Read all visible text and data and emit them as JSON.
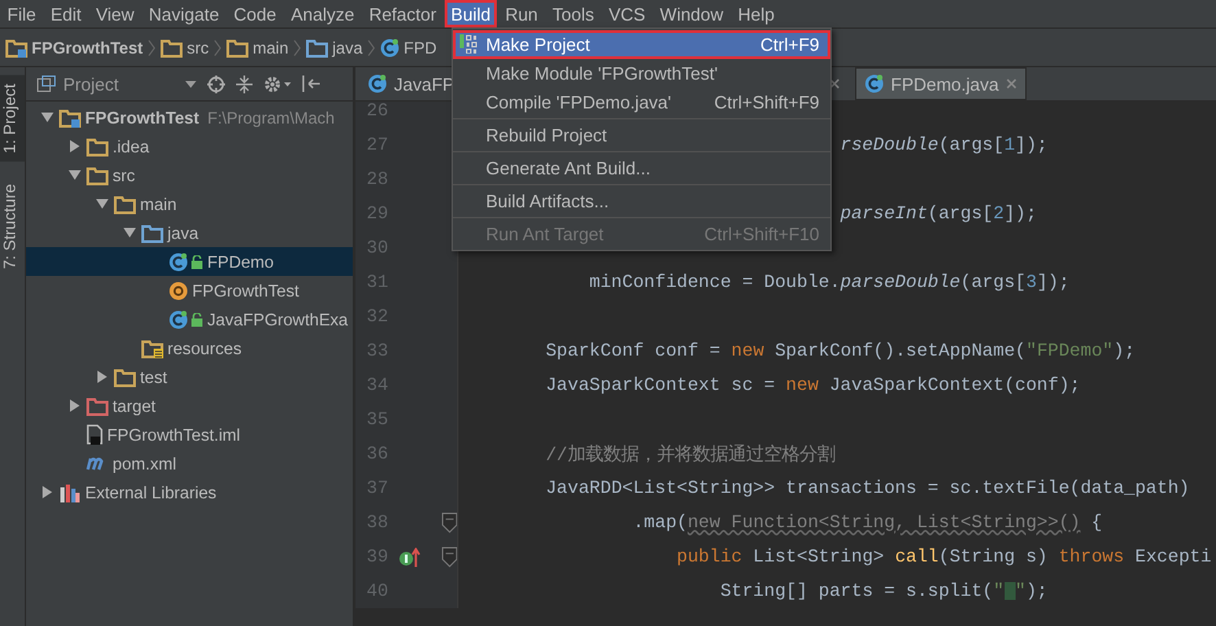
{
  "menu_bar": {
    "items": [
      {
        "label": "File",
        "selected": false,
        "annotated": false
      },
      {
        "label": "Edit",
        "selected": false,
        "annotated": false
      },
      {
        "label": "View",
        "selected": false,
        "annotated": false
      },
      {
        "label": "Navigate",
        "selected": false,
        "annotated": false
      },
      {
        "label": "Code",
        "selected": false,
        "annotated": false
      },
      {
        "label": "Analyze",
        "selected": false,
        "annotated": false
      },
      {
        "label": "Refactor",
        "selected": false,
        "annotated": false
      },
      {
        "label": "Build",
        "selected": true,
        "annotated": true
      },
      {
        "label": "Run",
        "selected": false,
        "annotated": false
      },
      {
        "label": "Tools",
        "selected": false,
        "annotated": false
      },
      {
        "label": "VCS",
        "selected": false,
        "annotated": false
      },
      {
        "label": "Window",
        "selected": false,
        "annotated": false
      },
      {
        "label": "Help",
        "selected": false,
        "annotated": false
      }
    ]
  },
  "build_menu": {
    "items": [
      {
        "kind": "icon-item",
        "label": "Make Project",
        "shortcut": "Ctrl+F9",
        "selected": true,
        "disabled": false,
        "annotated": true
      },
      {
        "kind": "item",
        "label": "Make Module 'FPGrowthTest'",
        "selected": false,
        "disabled": false,
        "annotated": false
      },
      {
        "kind": "item",
        "label": "Compile 'FPDemo.java'",
        "shortcut": "Ctrl+Shift+F9",
        "selected": false,
        "disabled": false,
        "annotated": false
      },
      {
        "kind": "separator"
      },
      {
        "kind": "item",
        "label": "Rebuild Project",
        "selected": false,
        "disabled": false,
        "annotated": false
      },
      {
        "kind": "separator"
      },
      {
        "kind": "item",
        "label": "Generate Ant Build...",
        "selected": false,
        "disabled": false,
        "annotated": false
      },
      {
        "kind": "separator"
      },
      {
        "kind": "item",
        "label": "Build Artifacts...",
        "selected": false,
        "disabled": false,
        "annotated": false
      },
      {
        "kind": "separator"
      },
      {
        "kind": "item",
        "label": "Run Ant Target",
        "shortcut": "Ctrl+Shift+F10",
        "selected": false,
        "disabled": true,
        "annotated": false
      }
    ]
  },
  "breadcrumbs": [
    {
      "label": "FPGrowthTest",
      "kind": "module"
    },
    {
      "label": "src",
      "kind": "folder"
    },
    {
      "label": "main",
      "kind": "folder"
    },
    {
      "label": "java",
      "kind": "source-folder"
    },
    {
      "label": "FPD",
      "kind": "class"
    }
  ],
  "tool_stripe": [
    {
      "label": "1: Project",
      "selected": true
    },
    {
      "label": "7: Structure",
      "selected": false
    }
  ],
  "project_panel": {
    "title": "Project",
    "tree": [
      {
        "label": "FPGrowthTest",
        "path": "F:\\Program\\Mach",
        "kind": "module",
        "expanded": true,
        "selected": false,
        "children": [
          {
            "label": ".idea",
            "kind": "folder",
            "expanded": false,
            "selected": false
          },
          {
            "label": "src",
            "kind": "folder",
            "expanded": true,
            "selected": false,
            "children": [
              {
                "label": "main",
                "kind": "folder",
                "expanded": true,
                "selected": false,
                "children": [
                  {
                    "label": "java",
                    "kind": "source-folder",
                    "expanded": true,
                    "selected": false,
                    "children": [
                      {
                        "label": "FPDemo",
                        "kind": "class",
                        "locked": true,
                        "selected": true
                      },
                      {
                        "label": "FPGrowthTest",
                        "kind": "object",
                        "selected": false
                      },
                      {
                        "label": "JavaFPGrowthExa",
                        "kind": "class",
                        "locked": true,
                        "selected": false
                      }
                    ]
                  },
                  {
                    "label": "resources",
                    "kind": "resource-folder",
                    "selected": false
                  }
                ]
              },
              {
                "label": "test",
                "kind": "folder",
                "expanded": false,
                "selected": false
              }
            ]
          },
          {
            "label": "target",
            "kind": "excluded-folder",
            "expanded": false,
            "selected": false
          },
          {
            "label": "FPGrowthTest.iml",
            "kind": "file",
            "selected": false
          },
          {
            "label": "pom.xml",
            "kind": "maven",
            "selected": false
          }
        ]
      },
      {
        "label": "External Libraries",
        "kind": "library",
        "expanded": false,
        "selected": false
      }
    ]
  },
  "editor": {
    "tabs": [
      {
        "label": "JavaFP",
        "selected": false
      },
      {
        "label": "FPDemo.java",
        "selected": true
      }
    ],
    "lines": [
      {
        "number": "26",
        "kind": "plain"
      },
      {
        "number": "27",
        "kind": "plain",
        "tokens": [
          {
            "text": "rseDouble",
            "kind": "static"
          },
          {
            "text": "(args[",
            "kind": "plain"
          },
          {
            "text": "1",
            "kind": "number"
          },
          {
            "text": "]);",
            "kind": "plain"
          }
        ]
      },
      {
        "number": "28",
        "kind": "plain"
      },
      {
        "number": "29",
        "kind": "plain",
        "tokens": [
          {
            "text": "parseInt",
            "kind": "static"
          },
          {
            "text": "(args[",
            "kind": "plain"
          },
          {
            "text": "2",
            "kind": "number"
          },
          {
            "text": "]);",
            "kind": "plain"
          }
        ]
      },
      {
        "number": "30",
        "kind": "plain"
      },
      {
        "number": "31",
        "kind": "plain",
        "tokens": [
          {
            "text": "minConfidence = Double.",
            "kind": "plain"
          },
          {
            "text": "parseDouble",
            "kind": "static"
          },
          {
            "text": "(args[",
            "kind": "plain"
          },
          {
            "text": "3",
            "kind": "number"
          },
          {
            "text": "]);",
            "kind": "plain"
          }
        ]
      },
      {
        "number": "32",
        "kind": "plain"
      },
      {
        "number": "33",
        "kind": "plain",
        "tokens": [
          {
            "text": "SparkConf conf = ",
            "kind": "plain"
          },
          {
            "text": "new",
            "kind": "keyword"
          },
          {
            "text": " SparkConf().setAppName(",
            "kind": "plain"
          },
          {
            "text": "\"FPDemo\"",
            "kind": "string"
          },
          {
            "text": ");",
            "kind": "plain"
          }
        ]
      },
      {
        "number": "34",
        "kind": "plain",
        "tokens": [
          {
            "text": "JavaSparkContext sc = ",
            "kind": "plain"
          },
          {
            "text": "new",
            "kind": "keyword"
          },
          {
            "text": " JavaSparkContext(conf);",
            "kind": "plain"
          }
        ]
      },
      {
        "number": "35",
        "kind": "plain"
      },
      {
        "number": "36",
        "kind": "plain",
        "tokens": [
          {
            "text": "//加载数据，并将数据通过空格分割",
            "kind": "comment"
          }
        ]
      },
      {
        "number": "37",
        "kind": "plain",
        "tokens": [
          {
            "text": "JavaRDD<List<String>> transactions = sc.textFile(data_path)",
            "kind": "plain"
          }
        ]
      },
      {
        "number": "38",
        "kind": "fold",
        "tokens": [
          {
            "text": ".map(",
            "kind": "plain"
          },
          {
            "text": "new Function<String, List<String>>()",
            "kind": "hint"
          },
          {
            "text": " {",
            "kind": "plain"
          }
        ]
      },
      {
        "number": "39",
        "kind": "fold-override",
        "tokens": [
          {
            "text": "public",
            "kind": "keyword"
          },
          {
            "text": " List<String> ",
            "kind": "plain"
          },
          {
            "text": "call",
            "kind": "method"
          },
          {
            "text": "(String s) ",
            "kind": "plain"
          },
          {
            "text": "throws",
            "kind": "keyword"
          },
          {
            "text": " Excepti",
            "kind": "plain"
          }
        ]
      },
      {
        "number": "40",
        "kind": "plain",
        "tokens": [
          {
            "text": "String[] parts = s.split(",
            "kind": "plain"
          },
          {
            "text": "\" \"",
            "kind": "marked-string"
          },
          {
            "text": ");",
            "kind": "plain"
          }
        ]
      }
    ]
  }
}
